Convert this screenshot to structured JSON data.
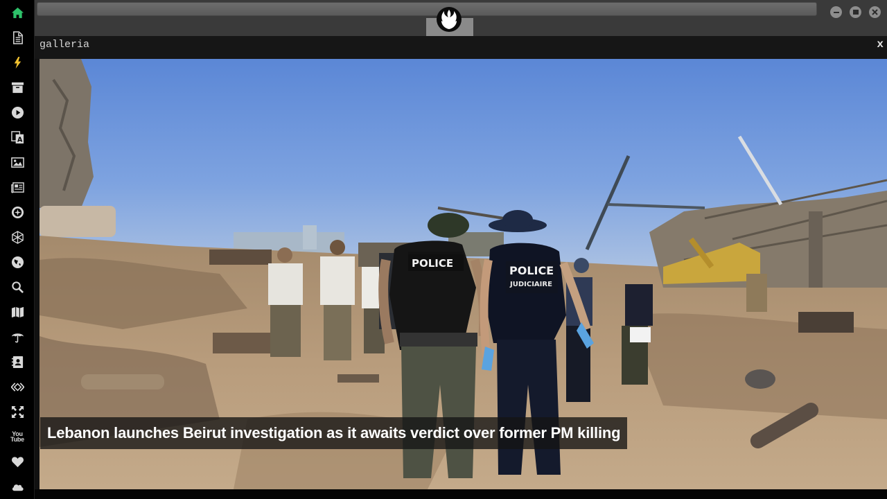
{
  "window": {
    "url": "",
    "panel_title": "galleria",
    "panel_close": "x"
  },
  "sidebar": {
    "items": [
      {
        "icon": "home-icon",
        "active": true
      },
      {
        "icon": "document-icon"
      },
      {
        "icon": "lightning-icon"
      },
      {
        "icon": "archive-icon"
      },
      {
        "icon": "play-icon"
      },
      {
        "icon": "translate-icon"
      },
      {
        "icon": "image-icon"
      },
      {
        "icon": "newspaper-icon"
      },
      {
        "icon": "rebel-badge-icon"
      },
      {
        "icon": "hexagon-network-icon"
      },
      {
        "icon": "globe-icon"
      },
      {
        "icon": "search-icon"
      },
      {
        "icon": "map-icon"
      },
      {
        "icon": "umbrella-icon"
      },
      {
        "icon": "contact-card-icon"
      },
      {
        "icon": "code-diamond-icon"
      },
      {
        "icon": "expand-arrows-icon"
      },
      {
        "icon": "youtube-icon",
        "text": "You Tube"
      },
      {
        "icon": "heart-icon"
      },
      {
        "icon": "cloud-icon"
      }
    ]
  },
  "gallery": {
    "caption": "Lebanon launches Beirut investigation as it awaits verdict over former PM killing",
    "image": "photo of investigators with POLICE JUDICIAIRE vests walking through blast debris at a port with destroyed silos and cranes under a blue sky",
    "vest_text_1": "POLICE",
    "vest_text_2": "JUDICIAIRE"
  },
  "colors": {
    "accent_active": "#2ec26a",
    "sidebar_bg": "#000000",
    "topbar_bg": "#3a3a3a",
    "panel_header_bg": "#161616"
  }
}
